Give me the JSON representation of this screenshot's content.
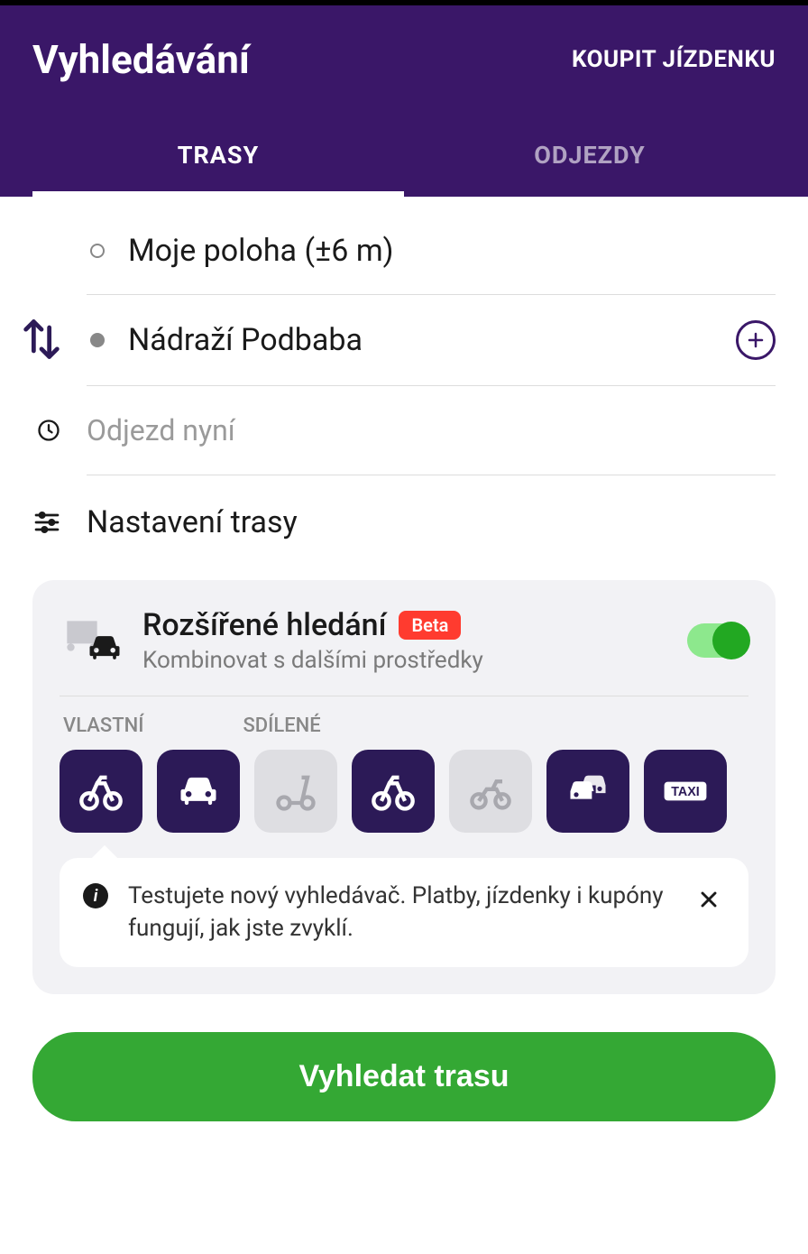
{
  "header": {
    "title": "Vyhledávání",
    "buy_ticket": "KOUPIT JÍZDENKU"
  },
  "tabs": {
    "routes": "TRASY",
    "departures": "ODJEZDY"
  },
  "route": {
    "from": "Moje poloha (±6 m)",
    "to": "Nádraží Podbaba",
    "time_placeholder": "Odjezd nyní",
    "settings": "Nastavení trasy"
  },
  "card": {
    "title": "Rozšířené hledání",
    "badge": "Beta",
    "subtitle": "Kombinovat s dalšími prostředky",
    "label_own": "VLASTNÍ",
    "label_shared": "SDÍLENÉ",
    "modes": [
      {
        "name": "own-bike",
        "on": true,
        "icon": "bike"
      },
      {
        "name": "own-car",
        "on": true,
        "icon": "car"
      },
      {
        "name": "shared-scooter",
        "on": false,
        "icon": "scooter"
      },
      {
        "name": "shared-bike",
        "on": true,
        "icon": "bike"
      },
      {
        "name": "shared-motorbike",
        "on": false,
        "icon": "motorbike"
      },
      {
        "name": "shared-car",
        "on": true,
        "icon": "carshare"
      },
      {
        "name": "taxi",
        "on": true,
        "icon": "taxi"
      }
    ],
    "note": "Testujete nový vyhledávač. Platby, jízdenky i kupóny fungují, jak jste zvyklí."
  },
  "search_button": "Vyhledat trasu"
}
